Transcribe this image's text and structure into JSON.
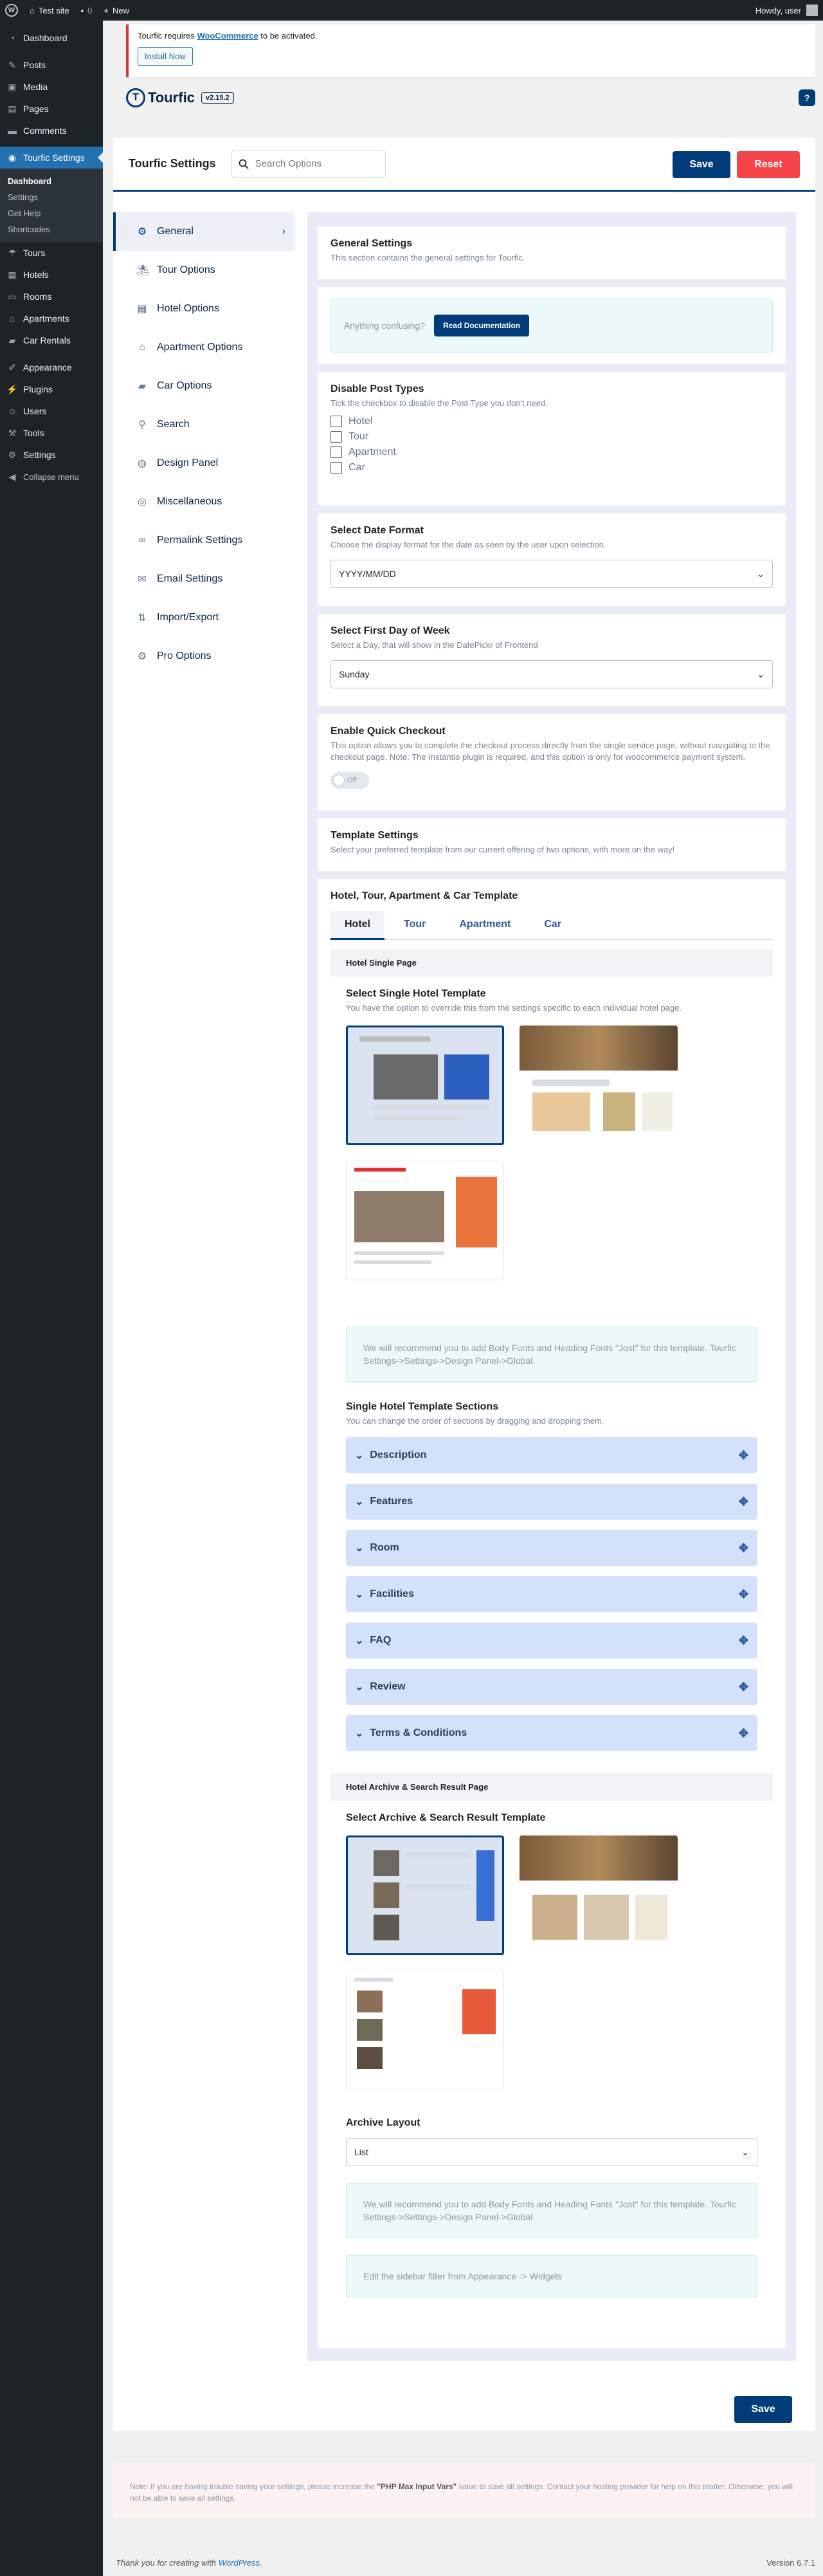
{
  "adminbar": {
    "site": "Test site",
    "comments": "0",
    "new": "New",
    "howdy": "Howdy, user"
  },
  "sidebar": {
    "items": [
      {
        "label": "Dashboard",
        "icon": "dashboard-icon"
      },
      {
        "label": "Posts",
        "icon": "pin-icon"
      },
      {
        "label": "Media",
        "icon": "media-icon"
      },
      {
        "label": "Pages",
        "icon": "page-icon"
      },
      {
        "label": "Comments",
        "icon": "comment-icon"
      },
      {
        "label": "Tourfic Settings",
        "icon": "tourfic-icon"
      }
    ],
    "submenu": [
      "Dashboard",
      "Settings",
      "Get Help",
      "Shortcodes"
    ],
    "items2": [
      {
        "label": "Tours",
        "icon": "tour-icon"
      },
      {
        "label": "Hotels",
        "icon": "hotel-icon"
      },
      {
        "label": "Rooms",
        "icon": "room-icon"
      },
      {
        "label": "Apartments",
        "icon": "apartment-icon"
      },
      {
        "label": "Car Rentals",
        "icon": "car-icon"
      }
    ],
    "items3": [
      {
        "label": "Appearance",
        "icon": "brush-icon"
      },
      {
        "label": "Plugins",
        "icon": "plugin-icon"
      },
      {
        "label": "Users",
        "icon": "users-icon"
      },
      {
        "label": "Tools",
        "icon": "tools-icon"
      },
      {
        "label": "Settings",
        "icon": "settings-icon"
      },
      {
        "label": "Collapse menu",
        "icon": "collapse-icon"
      }
    ]
  },
  "notice": {
    "text_before": "Tourfic requires",
    "link": "WooCommerce",
    "text_after": "to be activated.",
    "button": "Install Now"
  },
  "brand": {
    "name": "Tourfic",
    "version": "v2.15.2",
    "help": "?"
  },
  "header": {
    "title": "Tourfic Settings",
    "search_placeholder": "Search Options",
    "save": "Save",
    "reset": "Reset"
  },
  "nav": [
    {
      "label": "General",
      "icon": "gear-icon"
    },
    {
      "label": "Tour Options",
      "icon": "umbrella-icon"
    },
    {
      "label": "Hotel Options",
      "icon": "building-icon"
    },
    {
      "label": "Apartment Options",
      "icon": "house-icon"
    },
    {
      "label": "Car Options",
      "icon": "car-icon"
    },
    {
      "label": "Search",
      "icon": "search-icon"
    },
    {
      "label": "Design Panel",
      "icon": "palette-icon"
    },
    {
      "label": "Miscellaneous",
      "icon": "globe-icon"
    },
    {
      "label": "Permalink Settings",
      "icon": "link-icon"
    },
    {
      "label": "Email Settings",
      "icon": "envelope-icon"
    },
    {
      "label": "Import/Export",
      "icon": "import-icon"
    },
    {
      "label": "Pro Options",
      "icon": "gear-icon"
    }
  ],
  "general": {
    "title": "General Settings",
    "desc": "This section contains the general settings for Tourfic."
  },
  "doc": {
    "text": "Anything confusing?",
    "button": "Read Documentation"
  },
  "post_types": {
    "title": "Disable Post Types",
    "desc": "Tick the checkbox to disable the Post Type you don't need.",
    "options": [
      "Hotel",
      "Tour",
      "Apartment",
      "Car"
    ]
  },
  "date_format": {
    "title": "Select Date Format",
    "desc": "Choose the display format for the date as seen by the user upon selection.",
    "value": "YYYY/MM/DD"
  },
  "first_day": {
    "title": "Select First Day of Week",
    "desc": "Select a Day, that will show in the DatePickr of Frontend",
    "value": "Sunday"
  },
  "quick_checkout": {
    "title": "Enable Quick Checkout",
    "desc": "This option allows you to complete the checkout process directly from the single service page, without navigating to the checkout page. Note: The Instantio plugin is required, and this option is only for woocommerce payment system.",
    "toggle": "Off"
  },
  "template_settings": {
    "title": "Template Settings",
    "desc": "Select your preferred template from our current offering of two options, with more on the way!"
  },
  "template": {
    "title": "Hotel, Tour, Apartment & Car Template",
    "tabs": [
      "Hotel",
      "Tour",
      "Apartment",
      "Car"
    ],
    "single_bar": "Hotel Single Page",
    "single_title": "Select Single Hotel Template",
    "single_desc": "You have the option to override this from the settings specific to each individual hotel page.",
    "recommend1": "We will recommend you to add Body Fonts and Heading Fonts \"Jost\" for this template. Tourfic Settings->Settings->Design Panel->Global.",
    "sections_title": "Single Hotel Template Sections",
    "sections_desc": "You can change the order of sections by dragging and dropping them.",
    "sections": [
      "Description",
      "Features",
      "Room",
      "Facilities",
      "FAQ",
      "Review",
      "Terms & Conditions"
    ],
    "archive_bar": "Hotel Archive & Search Result Page",
    "archive_title": "Select Archive & Search Result Template",
    "layout_title": "Archive Layout",
    "layout_value": "List",
    "recommend2": "We will recommend you to add Body Fonts and Heading Fonts \"Jost\" for this template. Tourfic Settings->Settings->Design Panel->Global.",
    "sidebar_note": "Edit the sidebar filter from Appearance -> Widgets"
  },
  "footer_save": "Save",
  "note": {
    "prefix": "Note: If you are having trouble saving your settings, please increase the",
    "bold": "\"PHP Max Input Vars\"",
    "suffix": "value to save all settings. Contact your hosting provider for help on this matter. Otherwise, you will not be able to save all settings."
  },
  "wpfooter": {
    "thanks": "Thank you for creating with",
    "link": "WordPress",
    "period": ".",
    "version": "Version 6.7.1"
  }
}
